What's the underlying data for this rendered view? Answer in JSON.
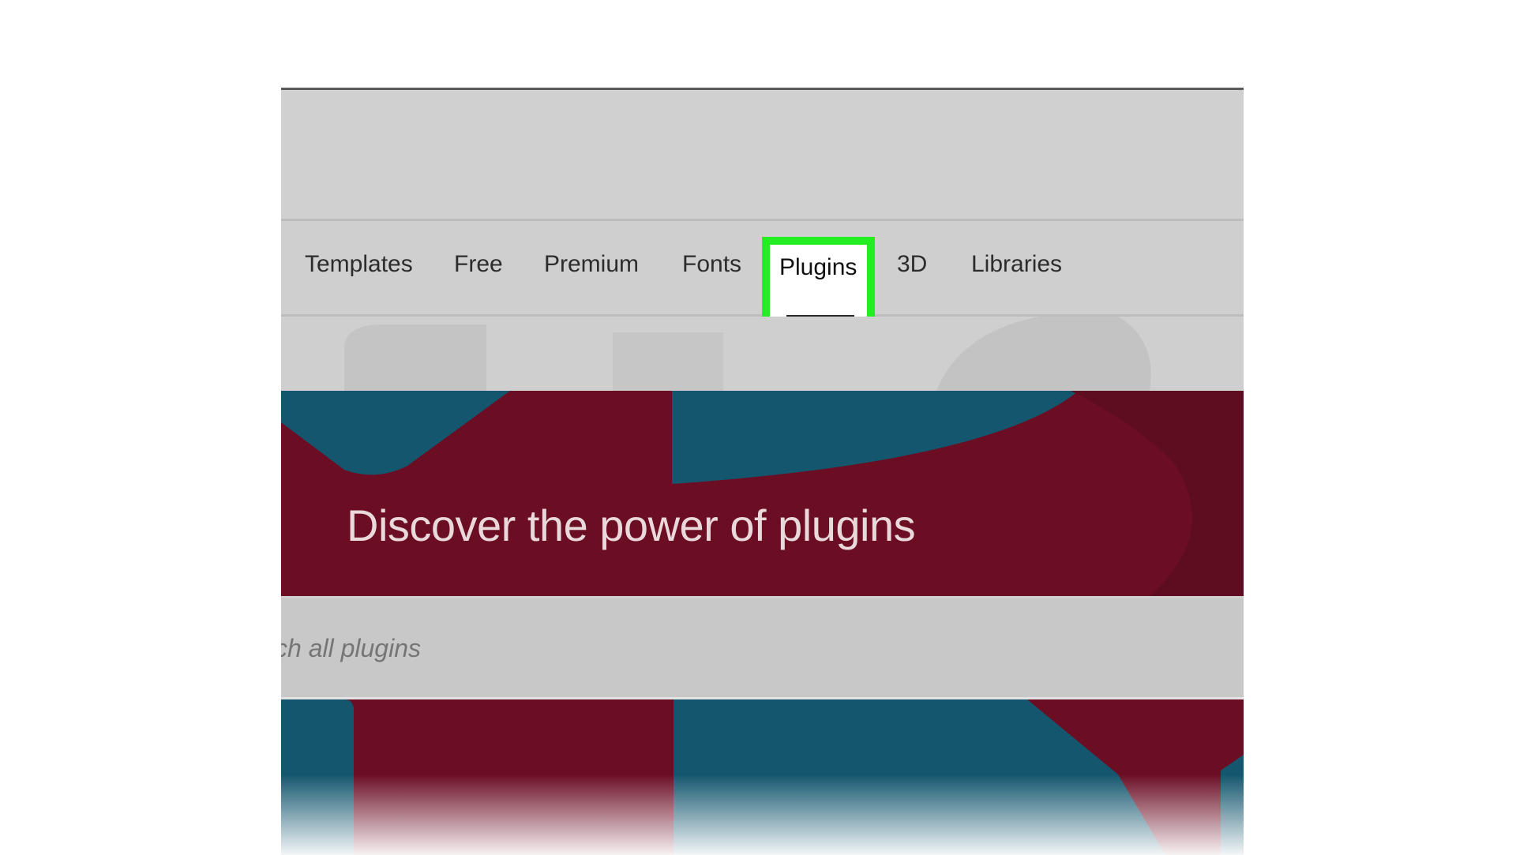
{
  "nav": {
    "items": [
      {
        "label": "Templates"
      },
      {
        "label": "Free"
      },
      {
        "label": "Premium"
      },
      {
        "label": "Fonts"
      },
      {
        "label": "Plugins",
        "active": true
      },
      {
        "label": "3D"
      },
      {
        "label": "Libraries"
      }
    ]
  },
  "hero": {
    "title": "Discover the power of plugins"
  },
  "search": {
    "placeholder": "ch all plugins"
  },
  "colors": {
    "highlight": "#22ee22",
    "hero_red": "#6b0e24",
    "hero_blue": "#14566e"
  }
}
